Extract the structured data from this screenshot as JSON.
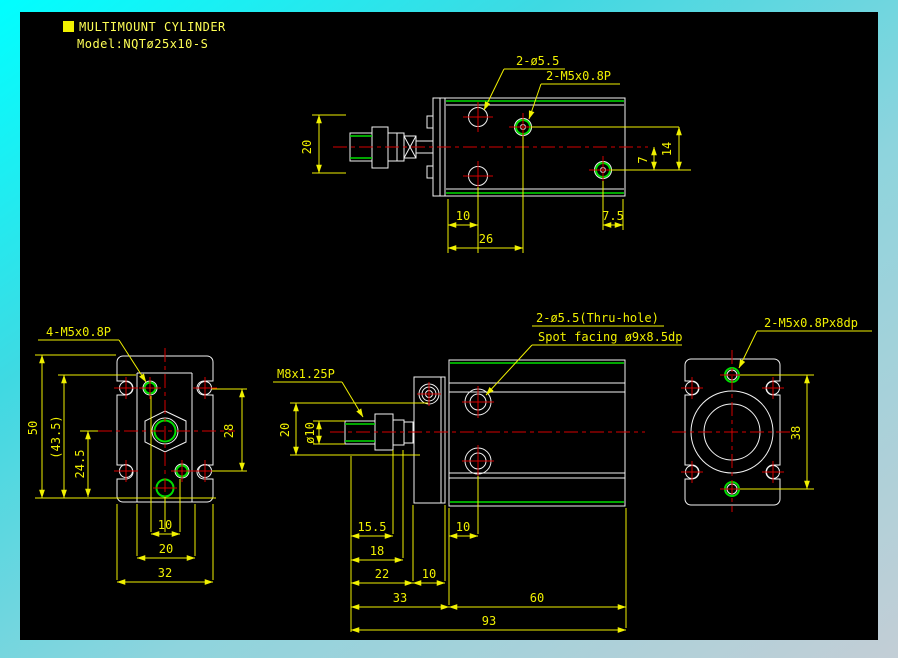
{
  "title": {
    "line1": "MULTIMOUNT CYLINDER",
    "line2": "Model:NQTø25x10-S"
  },
  "colors": {
    "canvas": "#000000",
    "geometry": "#f2f2f2",
    "thread_green": "#00dd00",
    "centerline_red": "#d40000",
    "dimension_yellow": "#f0f000",
    "title_yellow": "#ffff55",
    "frame_gradient_start": "#00ffff",
    "frame_gradient_end": "#c3ced6"
  },
  "top_view": {
    "label_holes": "2-ø5.5",
    "label_thread_holes": "2-M5x0.8P",
    "dim_rod_width": "20",
    "dim_center_offset": "7",
    "dim_hole_spacing": "14",
    "dim_hole_offset": "10",
    "dim_hole_span": "26",
    "dim_edge_offset": "7.5"
  },
  "front_view": {
    "label_thread_holes": "4-M5x0.8P",
    "dim_height": "50",
    "dim_ref_height": "(43.5)",
    "dim_port_offset": "24.5",
    "dim_hole_span_v": "28",
    "dim_hole_span_h": "10",
    "dim_body_width": "20",
    "dim_width": "32"
  },
  "side_view": {
    "label_thru_hole_line1": "2-ø5.5(Thru-hole)",
    "label_thru_hole_line2": "Spot facing ø9x8.5dp",
    "label_rod_thread": "M8x1.25P",
    "dim_plate_height": "20",
    "dim_rod_diameter": "ø10",
    "dim_rod_length": "15.5",
    "dim_18": "18",
    "dim_22": "22",
    "dim_plate_thickness": "10",
    "dim_hole_offset": "10",
    "dim_33": "33",
    "dim_body_length": "60",
    "dim_total_length": "93"
  },
  "end_view": {
    "label_thread_holes": "2-M5x0.8Px8dp",
    "dim_hole_span": "38"
  }
}
